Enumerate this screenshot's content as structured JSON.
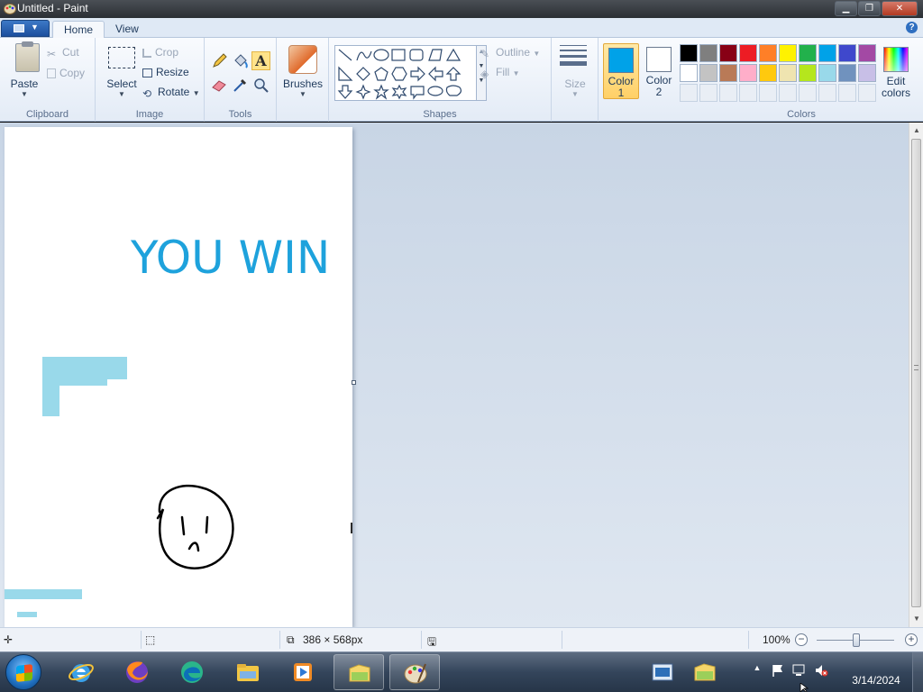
{
  "window": {
    "title": "Untitled - Paint",
    "controls": [
      "minimize",
      "maximize",
      "close"
    ]
  },
  "ribbon": {
    "tabs": [
      {
        "label": "Home",
        "active": true
      },
      {
        "label": "View",
        "active": false
      }
    ],
    "clipboard": {
      "group_label": "Clipboard",
      "paste": "Paste",
      "cut": "Cut",
      "copy": "Copy"
    },
    "image": {
      "group_label": "Image",
      "select": "Select",
      "crop": "Crop",
      "resize": "Resize",
      "rotate": "Rotate"
    },
    "tools": {
      "group_label": "Tools",
      "items": [
        "pencil-icon",
        "fill-icon",
        "text-icon",
        "eraser-icon",
        "color-picker-icon",
        "magnifier-icon"
      ],
      "active": "text-icon"
    },
    "brushes": {
      "label": "Brushes"
    },
    "shapes": {
      "group_label": "Shapes",
      "outline": "Outline",
      "fill": "Fill"
    },
    "size": {
      "label": "Size"
    },
    "colors": {
      "group_label": "Colors",
      "color1": {
        "label1": "Color",
        "label2": "1",
        "value": "#00a2e8"
      },
      "color2": {
        "label1": "Color",
        "label2": "2",
        "value": "#ffffff"
      },
      "palette_row1": [
        "#000000",
        "#7f7f7f",
        "#880015",
        "#ed1c24",
        "#ff7f27",
        "#fff200",
        "#22b14c",
        "#00a2e8",
        "#3f48cc",
        "#a349a4"
      ],
      "palette_row2": [
        "#ffffff",
        "#c3c3c3",
        "#b97a57",
        "#ffaec9",
        "#ffc90e",
        "#efe4b0",
        "#b5e61d",
        "#99d9ea",
        "#7092be",
        "#c8bfe7"
      ],
      "edit_colors_1": "Edit",
      "edit_colors_2": "colors"
    }
  },
  "canvas": {
    "text": "YOU WIN",
    "text_color": "#1ea2dc",
    "shape_color": "#99d9ea"
  },
  "statusbar": {
    "dimensions": "386 × 568px",
    "zoom": "100%"
  },
  "taskbar": {
    "apps": [
      "internet-explorer-icon",
      "firefox-icon",
      "edge-icon",
      "file-explorer-icon",
      "media-player-icon",
      "folder-icon",
      "paint-icon"
    ],
    "tray": [
      "action-center-flag-icon",
      "network-icon",
      "volume-muted-icon"
    ],
    "clock_date": "3/14/2024"
  }
}
